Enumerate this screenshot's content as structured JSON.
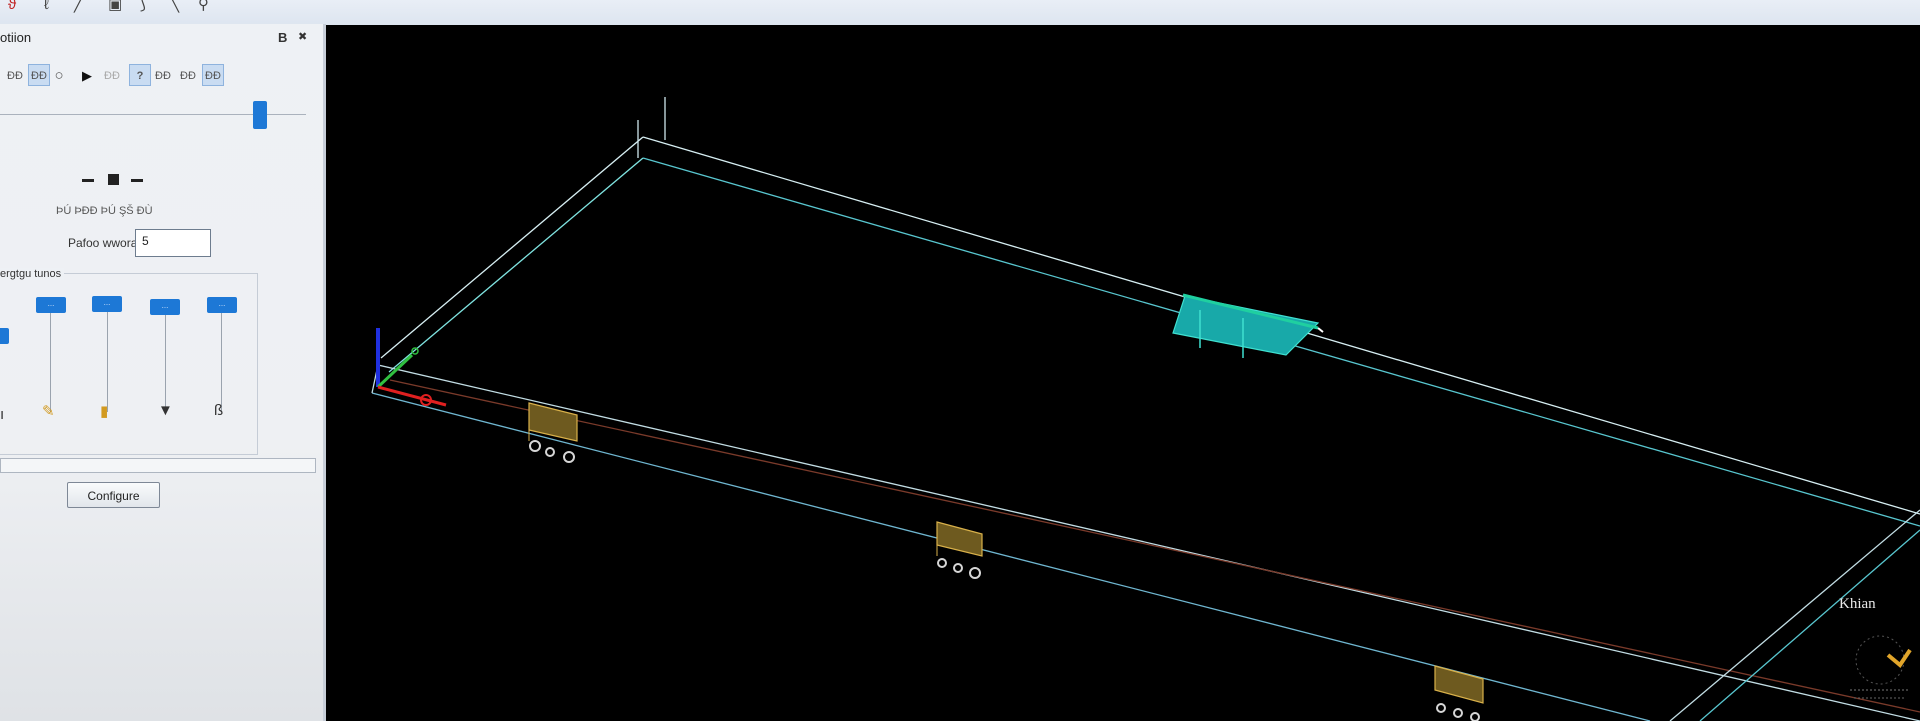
{
  "panel": {
    "title": "otiion",
    "pin_label": "B",
    "close_label": "✖",
    "toolbar_labels": [
      "ĐĐ",
      "ĐĐ",
      "○",
      "▶",
      "ĐĐ",
      "?",
      "ĐĐ",
      "ĐĐ",
      "ĐĐ"
    ],
    "mini_labels": "ÞÚ ÞĐÐ ÞÚ ŞŠ ÐÙ",
    "field_label": "Pafoo wwora",
    "field_value": "5",
    "group_label": "ergtgu tunos",
    "configure_label": "Configure",
    "slider_thumb_labels": [
      "...",
      "...",
      "...",
      "..."
    ]
  },
  "watermark": {
    "text": "Khian"
  },
  "colors": {
    "accent": "#1d78d6",
    "viewport_bg": "#000000",
    "wire": "#a8e3ee",
    "cyan_part": "#19b2b2",
    "gold_part": "#c9a241",
    "axis_x": "#e02020",
    "axis_y": "#30c040",
    "axis_z": "#2020d0"
  },
  "icons": [
    "curve-tool-icon",
    "line-tool-icon",
    "save-icon",
    "play-icon",
    "help-icon",
    "grid-icon",
    "wrench-icon",
    "brush-icon",
    "pin-icon",
    "bowl-icon",
    "tool-icon"
  ]
}
